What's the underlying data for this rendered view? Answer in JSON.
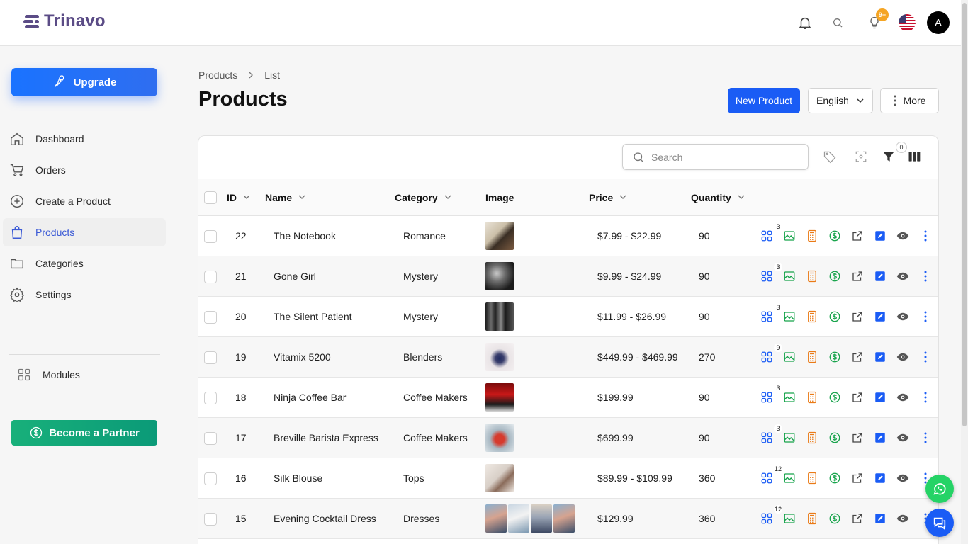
{
  "brand": {
    "name": "Trinavo"
  },
  "header": {
    "notifications_badge": "9+",
    "avatar_letter": "A"
  },
  "sidebar": {
    "upgrade_label": "Upgrade",
    "items": [
      {
        "label": "Dashboard",
        "icon": "home-icon"
      },
      {
        "label": "Orders",
        "icon": "cart-icon"
      },
      {
        "label": "Create a Product",
        "icon": "plus-circle-icon"
      },
      {
        "label": "Products",
        "icon": "bag-icon",
        "active": true
      },
      {
        "label": "Categories",
        "icon": "folder-icon"
      },
      {
        "label": "Settings",
        "icon": "gear-icon"
      }
    ],
    "modules_label": "Modules",
    "partner_label": "Become a Partner"
  },
  "breadcrumb": {
    "parent": "Products",
    "current": "List"
  },
  "page": {
    "title": "Products"
  },
  "actions": {
    "new_label": "New Product",
    "language": "English",
    "more_label": "More"
  },
  "search": {
    "placeholder": "Search"
  },
  "toolbar": {
    "filter_count": "0"
  },
  "table": {
    "columns": {
      "id": "ID",
      "name": "Name",
      "category": "Category",
      "image": "Image",
      "price": "Price",
      "quantity": "Quantity"
    },
    "rows": [
      {
        "id": "22",
        "name": "The Notebook",
        "category": "Romance",
        "price": "$7.99 - $22.99",
        "quantity": "90",
        "count": "3"
      },
      {
        "id": "21",
        "name": "Gone Girl",
        "category": "Mystery",
        "price": "$9.99 - $24.99",
        "quantity": "90",
        "count": "3"
      },
      {
        "id": "20",
        "name": "The Silent Patient",
        "category": "Mystery",
        "price": "$11.99 - $26.99",
        "quantity": "90",
        "count": "3"
      },
      {
        "id": "19",
        "name": "Vitamix 5200",
        "category": "Blenders",
        "price": "$449.99 - $469.99",
        "quantity": "270",
        "count": "9"
      },
      {
        "id": "18",
        "name": "Ninja Coffee Bar",
        "category": "Coffee Makers",
        "price": "$199.99",
        "quantity": "90",
        "count": "3"
      },
      {
        "id": "17",
        "name": "Breville Barista Express",
        "category": "Coffee Makers",
        "price": "$699.99",
        "quantity": "90",
        "count": "3"
      },
      {
        "id": "16",
        "name": "Silk Blouse",
        "category": "Tops",
        "price": "$89.99 - $109.99",
        "quantity": "360",
        "count": "12"
      },
      {
        "id": "15",
        "name": "Evening Cocktail Dress",
        "category": "Dresses",
        "price": "$129.99",
        "quantity": "360",
        "count": "12"
      }
    ]
  },
  "colors": {
    "primary": "#1a5cf5",
    "brand": "#5b4c86",
    "partner": "#18b07a",
    "whatsapp": "#25d366"
  }
}
